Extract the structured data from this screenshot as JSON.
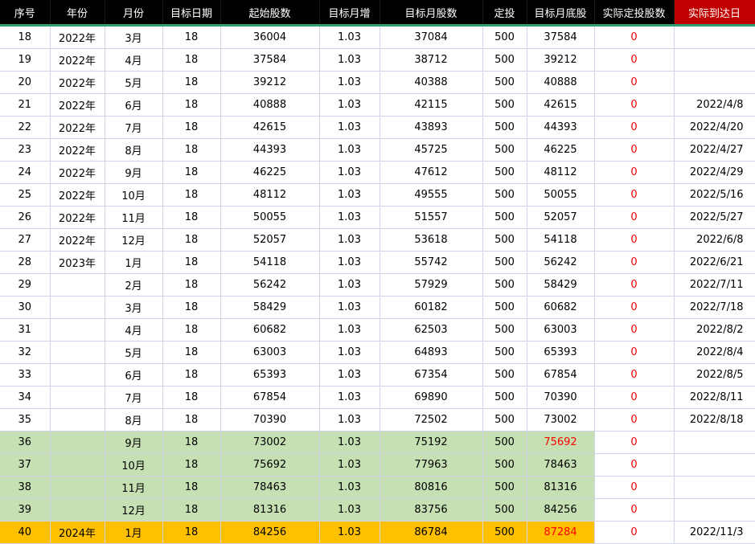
{
  "headers": [
    "序号",
    "年份",
    "月份",
    "目标日期",
    "起始股数",
    "目标月增",
    "目标月股数",
    "定投",
    "目标月底股",
    "实际定投股数",
    "实际到达日"
  ],
  "rows": [
    {
      "no": "18",
      "year": "2022年",
      "month": "3月",
      "day": "18",
      "start": "36004",
      "growth": "1.03",
      "target": "37084",
      "invest": "500",
      "end": "37584",
      "actual": "0",
      "date": ""
    },
    {
      "no": "19",
      "year": "2022年",
      "month": "4月",
      "day": "18",
      "start": "37584",
      "growth": "1.03",
      "target": "38712",
      "invest": "500",
      "end": "39212",
      "actual": "0",
      "date": ""
    },
    {
      "no": "20",
      "year": "2022年",
      "month": "5月",
      "day": "18",
      "start": "39212",
      "growth": "1.03",
      "target": "40388",
      "invest": "500",
      "end": "40888",
      "actual": "0",
      "date": ""
    },
    {
      "no": "21",
      "year": "2022年",
      "month": "6月",
      "day": "18",
      "start": "40888",
      "growth": "1.03",
      "target": "42115",
      "invest": "500",
      "end": "42615",
      "actual": "0",
      "date": "2022/4/8"
    },
    {
      "no": "22",
      "year": "2022年",
      "month": "7月",
      "day": "18",
      "start": "42615",
      "growth": "1.03",
      "target": "43893",
      "invest": "500",
      "end": "44393",
      "actual": "0",
      "date": "2022/4/20"
    },
    {
      "no": "23",
      "year": "2022年",
      "month": "8月",
      "day": "18",
      "start": "44393",
      "growth": "1.03",
      "target": "45725",
      "invest": "500",
      "end": "46225",
      "actual": "0",
      "date": "2022/4/27"
    },
    {
      "no": "24",
      "year": "2022年",
      "month": "9月",
      "day": "18",
      "start": "46225",
      "growth": "1.03",
      "target": "47612",
      "invest": "500",
      "end": "48112",
      "actual": "0",
      "date": "2022/4/29"
    },
    {
      "no": "25",
      "year": "2022年",
      "month": "10月",
      "day": "18",
      "start": "48112",
      "growth": "1.03",
      "target": "49555",
      "invest": "500",
      "end": "50055",
      "actual": "0",
      "date": "2022/5/16"
    },
    {
      "no": "26",
      "year": "2022年",
      "month": "11月",
      "day": "18",
      "start": "50055",
      "growth": "1.03",
      "target": "51557",
      "invest": "500",
      "end": "52057",
      "actual": "0",
      "date": "2022/5/27"
    },
    {
      "no": "27",
      "year": "2022年",
      "month": "12月",
      "day": "18",
      "start": "52057",
      "growth": "1.03",
      "target": "53618",
      "invest": "500",
      "end": "54118",
      "actual": "0",
      "date": "2022/6/8"
    },
    {
      "no": "28",
      "year": "2023年",
      "month": "1月",
      "day": "18",
      "start": "54118",
      "growth": "1.03",
      "target": "55742",
      "invest": "500",
      "end": "56242",
      "actual": "0",
      "date": "2022/6/21"
    },
    {
      "no": "29",
      "year": "",
      "month": "2月",
      "day": "18",
      "start": "56242",
      "growth": "1.03",
      "target": "57929",
      "invest": "500",
      "end": "58429",
      "actual": "0",
      "date": "2022/7/11"
    },
    {
      "no": "30",
      "year": "",
      "month": "3月",
      "day": "18",
      "start": "58429",
      "growth": "1.03",
      "target": "60182",
      "invest": "500",
      "end": "60682",
      "actual": "0",
      "date": "2022/7/18"
    },
    {
      "no": "31",
      "year": "",
      "month": "4月",
      "day": "18",
      "start": "60682",
      "growth": "1.03",
      "target": "62503",
      "invest": "500",
      "end": "63003",
      "actual": "0",
      "date": "2022/8/2"
    },
    {
      "no": "32",
      "year": "",
      "month": "5月",
      "day": "18",
      "start": "63003",
      "growth": "1.03",
      "target": "64893",
      "invest": "500",
      "end": "65393",
      "actual": "0",
      "date": "2022/8/4"
    },
    {
      "no": "33",
      "year": "",
      "month": "6月",
      "day": "18",
      "start": "65393",
      "growth": "1.03",
      "target": "67354",
      "invest": "500",
      "end": "67854",
      "actual": "0",
      "date": "2022/8/5"
    },
    {
      "no": "34",
      "year": "",
      "month": "7月",
      "day": "18",
      "start": "67854",
      "growth": "1.03",
      "target": "69890",
      "invest": "500",
      "end": "70390",
      "actual": "0",
      "date": "2022/8/11"
    },
    {
      "no": "35",
      "year": "",
      "month": "8月",
      "day": "18",
      "start": "70390",
      "growth": "1.03",
      "target": "72502",
      "invest": "500",
      "end": "73002",
      "actual": "0",
      "date": "2022/8/18"
    },
    {
      "no": "36",
      "year": "",
      "month": "9月",
      "day": "18",
      "start": "73002",
      "growth": "1.03",
      "target": "75192",
      "invest": "500",
      "end": "75692",
      "actual": "0",
      "date": "",
      "style": "green",
      "endRed": true
    },
    {
      "no": "37",
      "year": "",
      "month": "10月",
      "day": "18",
      "start": "75692",
      "growth": "1.03",
      "target": "77963",
      "invest": "500",
      "end": "78463",
      "actual": "0",
      "date": "",
      "style": "green"
    },
    {
      "no": "38",
      "year": "",
      "month": "11月",
      "day": "18",
      "start": "78463",
      "growth": "1.03",
      "target": "80816",
      "invest": "500",
      "end": "81316",
      "actual": "0",
      "date": "",
      "style": "green"
    },
    {
      "no": "39",
      "year": "",
      "month": "12月",
      "day": "18",
      "start": "81316",
      "growth": "1.03",
      "target": "83756",
      "invest": "500",
      "end": "84256",
      "actual": "0",
      "date": "",
      "style": "green"
    },
    {
      "no": "40",
      "year": "2024年",
      "month": "1月",
      "day": "18",
      "start": "84256",
      "growth": "1.03",
      "target": "86784",
      "invest": "500",
      "end": "87284",
      "actual": "0",
      "date": "2022/11/3",
      "style": "gold",
      "endRed": true
    }
  ],
  "colors": {
    "header_bg": "#000000",
    "header_highlight": "#c00000",
    "green_fill": "#c6e0b4",
    "gold_fill": "#ffc000",
    "zero_red": "#ff0000"
  }
}
